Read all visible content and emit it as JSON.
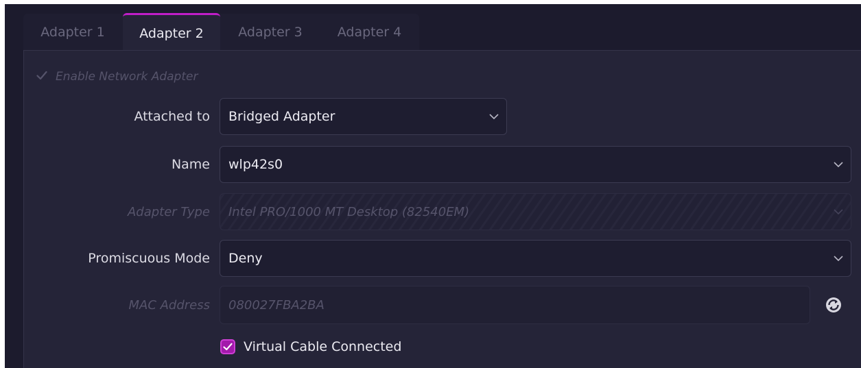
{
  "tabs": [
    {
      "label": "Adapter 1",
      "active": false
    },
    {
      "label": "Adapter 2",
      "active": true
    },
    {
      "label": "Adapter 3",
      "active": false
    },
    {
      "label": "Adapter 4",
      "active": false
    }
  ],
  "enable_adapter": {
    "label": "Enable Network Adapter",
    "checked": true,
    "enabled": false
  },
  "fields": {
    "attached_to": {
      "label": "Attached to",
      "value": "Bridged Adapter"
    },
    "name": {
      "label": "Name",
      "value": "wlp42s0"
    },
    "adapter_type": {
      "label": "Adapter Type",
      "value": "Intel PRO/1000 MT Desktop (82540EM)"
    },
    "promiscuous_mode": {
      "label": "Promiscuous Mode",
      "value": "Deny"
    },
    "mac_address": {
      "label": "MAC Address",
      "value": "080027FBA2BA"
    }
  },
  "virtual_cable": {
    "label": "Virtual Cable Connected",
    "checked": true
  },
  "icons": {
    "chevron": "chevron-down-icon",
    "refresh": "refresh-mac-icon",
    "check": "check-icon"
  },
  "colors": {
    "accent": "#c01ec8",
    "background": "#1c1b2d",
    "panel": "#252438"
  }
}
